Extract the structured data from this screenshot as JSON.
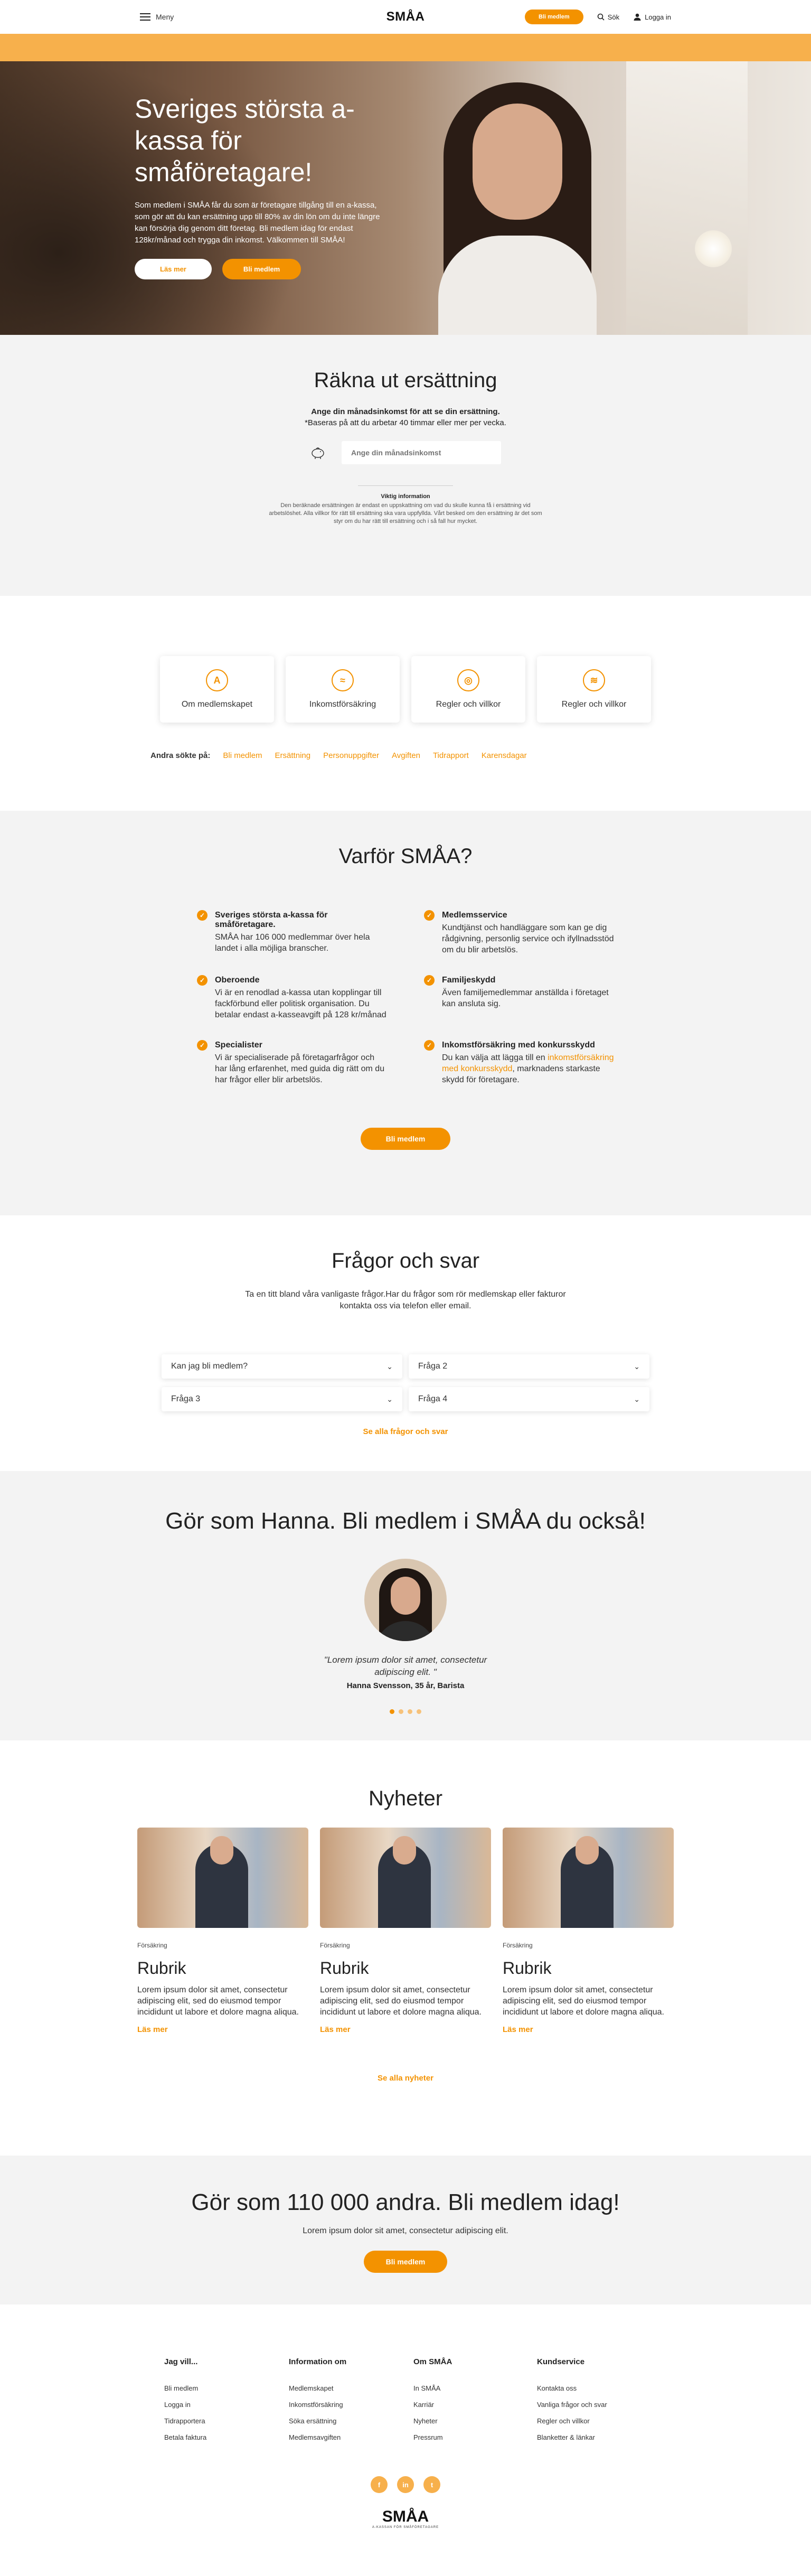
{
  "header": {
    "menu_label": "Meny",
    "logo_text": "SMÅA",
    "cta_label": "Bli medlem",
    "search_label": "Sök",
    "login_label": "Logga in"
  },
  "hero": {
    "title": "Sveriges största a-kassa för småföretagare!",
    "text": "Som medlem i SMÅA får du som är företagare tillgång till en a-kassa, som gör att du kan ersättning upp till 80% av din lön om du inte längre kan försörja dig genom ditt företag. Bli medlem idag för endast 128kr/månad och trygga din inkomst. Välkommen till SMÅA!",
    "btn_more": "Läs mer",
    "btn_join": "Bli medlem"
  },
  "calc": {
    "title": "Räkna ut ersättning",
    "sub1": "Ange din månadsinkomst för att se din ersättning.",
    "sub2": "*Baseras på att du arbetar 40 timmar eller mer per vecka.",
    "input_placeholder": "Ange din månadsinkomst",
    "info_title": "Viktig information",
    "info_text": "Den beräknade ersättningen är endast en uppskattning om vad du skulle kunna få i ersättning vid arbetslöshet. Alla villkor för rätt till ersättning ska vara uppfyllda. Vårt besked om den ersättning är det som styr om du har rätt till ersättning och i så fall hur mycket."
  },
  "cards": [
    {
      "label": "Om medlemskapet",
      "icon": "A"
    },
    {
      "label": "Inkomstförsäkring",
      "icon": "≈"
    },
    {
      "label": "Regler och villkor",
      "icon": "◎"
    },
    {
      "label": "Regler och villkor",
      "icon": "≋"
    }
  ],
  "others": {
    "label": "Andra sökte på:",
    "links": [
      "Bli medlem",
      "Ersättning",
      "Personuppgifter",
      "Avgiften",
      "Tidrapport",
      "Karensdagar"
    ]
  },
  "why": {
    "title": "Varför SMÅA?",
    "items": [
      {
        "title": "Sveriges största a-kassa för småföretagare.",
        "text": "SMÅA har 106 000 medlemmar över hela landet i alla möjliga branscher."
      },
      {
        "title": "Medlemsservice",
        "text": "Kundtjänst och handläggare som kan ge dig rådgivning, personlig service och ifyllnadsstöd om du blir arbetslös."
      },
      {
        "title": "Oberoende",
        "text": "Vi är en renodlad a-kassa utan kopplingar till fackförbund eller politisk organisation. Du betalar endast a-kasseavgift på 128 kr/månad"
      },
      {
        "title": "Familjeskydd",
        "text": "Även familjemedlemmar anställda i företaget kan ansluta sig."
      },
      {
        "title": "Specialister",
        "text": "Vi är specialiserade på företagarfrågor och har lång erfarenhet, med guida dig rätt om du har frågor eller blir arbetslös."
      },
      {
        "title": "Inkomstförsäkring med konkursskydd",
        "text_before": "Du kan välja att lägga till en",
        "link": "inkomstförsäkring med konkursskydd",
        "text_after": ", marknadens starkaste skydd för företagare."
      }
    ],
    "btn": "Bli medlem"
  },
  "faq": {
    "title": "Frågor och svar",
    "intro": "Ta en titt bland våra vanligaste frågor.Har du frågor som rör medlemskap eller fakturor kontakta oss via telefon eller email.",
    "items": [
      "Kan jag bli medlem?",
      "Fråga 2",
      "Fråga 3",
      "Fråga 4"
    ],
    "see_all": "Se alla frågor och svar"
  },
  "testimonial": {
    "title": "Gör som Hanna. Bli medlem i SMÅA du också!",
    "quote": "\"Lorem ipsum dolor sit amet, consectetur adipiscing elit. \"",
    "author": "Hanna Svensson, 35 år, Barista"
  },
  "news": {
    "title": "Nyheter",
    "items": [
      {
        "category": "Försäkring",
        "title": "Rubrik",
        "text": "Lorem ipsum dolor sit amet, consectetur adipiscing elit, sed do eiusmod tempor incididunt ut labore et dolore magna aliqua.",
        "more": "Läs mer"
      },
      {
        "category": "Försäkring",
        "title": "Rubrik",
        "text": "Lorem ipsum dolor sit amet, consectetur adipiscing elit, sed do eiusmod tempor incididunt ut labore et dolore magna aliqua.",
        "more": "Läs mer"
      },
      {
        "category": "Försäkring",
        "title": "Rubrik",
        "text": "Lorem ipsum dolor sit amet, consectetur adipiscing elit, sed do eiusmod tempor incididunt ut labore et dolore magna aliqua.",
        "more": "Läs mer"
      }
    ],
    "see_all": "Se alla nyheter"
  },
  "cta": {
    "title": "Gör som 110 000 andra. Bli medlem idag!",
    "sub": "Lorem ipsum dolor sit amet, consectetur adipiscing elit.",
    "btn": "Bli medlem"
  },
  "footer": {
    "cols": [
      {
        "head": "Jag vill...",
        "links": [
          "Bli medlem",
          "Logga in",
          "Tidrapportera",
          "Betala faktura"
        ]
      },
      {
        "head": "Information om",
        "links": [
          "Medlemskapet",
          "Inkomstförsäkring",
          "Söka ersättning",
          "Medlemsavgiften"
        ]
      },
      {
        "head": "Om SMÅA",
        "links": [
          "In SMÅA",
          "Karriär",
          "Nyheter",
          "Pressrum"
        ]
      },
      {
        "head": "Kundservice",
        "links": [
          "Kontakta oss",
          "Vanliga frågor och svar",
          "Regler och villkor",
          "Blanketter & länkar"
        ]
      }
    ],
    "social": [
      "f",
      "in",
      "t"
    ],
    "logo_text": "SMÅA",
    "tagline": "A-KASSAN FÖR SMÅFÖRETAGARE"
  },
  "colors": {
    "accent": "#f39200",
    "band": "#f7b04c",
    "section_bg": "#f3f3f3"
  }
}
